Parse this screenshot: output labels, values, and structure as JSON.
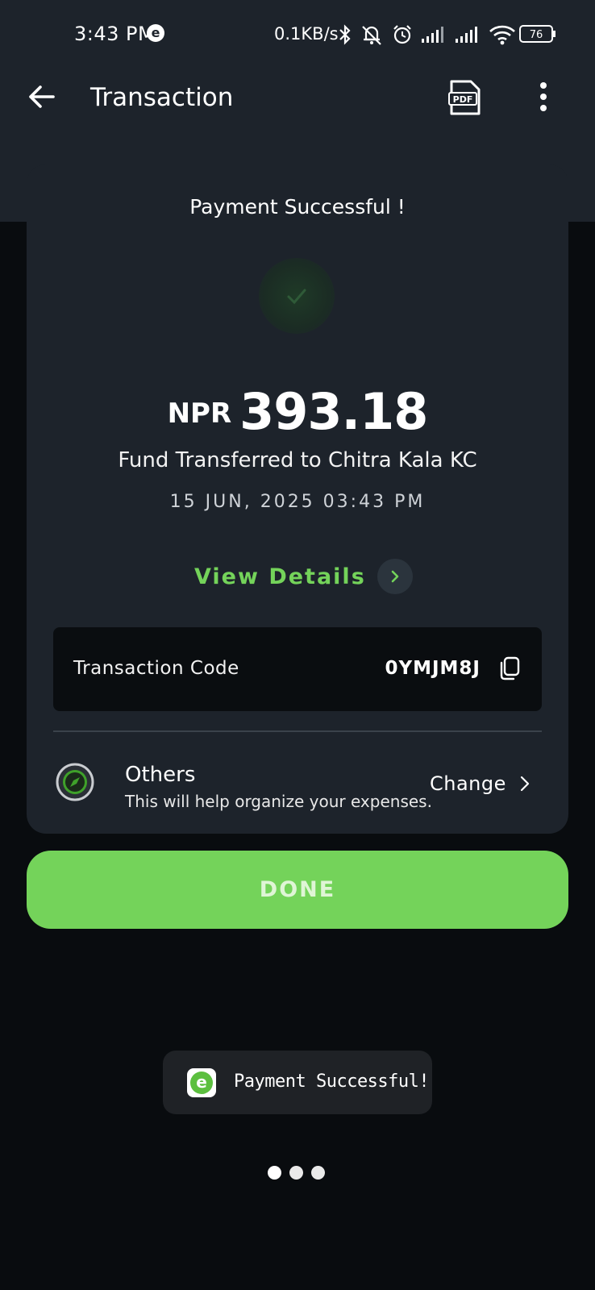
{
  "status_bar": {
    "time": "3:43 PM",
    "app_badge": "e",
    "net_speed": "0.1KB/s",
    "battery": "76"
  },
  "app_bar": {
    "title": "Transaction",
    "pdf_label": "PDF"
  },
  "receipt": {
    "heading": "Payment Successful !",
    "currency": "NPR",
    "amount": "393.18",
    "description": "Fund Transferred to Chitra Kala KC",
    "datetime": "15 JUN, 2025 03:43 PM",
    "view_details_label": "View Details",
    "transaction_code_label": "Transaction Code",
    "transaction_code": "0YMJM8J",
    "category_title": "Others",
    "category_subtitle": "This will help organize your expenses.",
    "change_label": "Change"
  },
  "actions": {
    "done_label": "DONE"
  },
  "toast": {
    "icon_letter": "e",
    "message": "Payment Successful!"
  },
  "pager": {
    "count": 3,
    "active_index": 0
  },
  "colors": {
    "accent_green": "#74d35a",
    "surface": "#1d232b",
    "background": "#090c0f"
  }
}
